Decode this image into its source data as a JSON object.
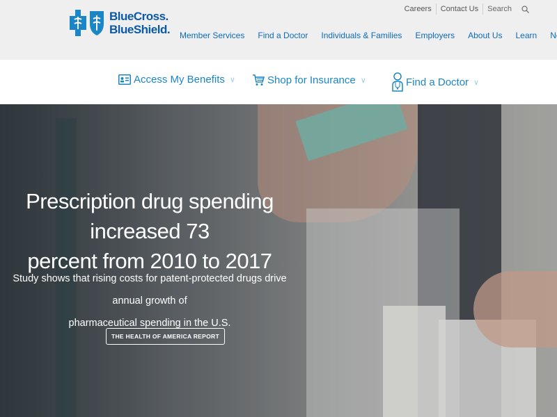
{
  "brand": {
    "line1": "BlueCross.",
    "line2": "BlueShield.",
    "color": "#0b5aa6"
  },
  "utility_nav": {
    "links": [
      "Careers",
      "Contact Us"
    ],
    "search_label": "Search",
    "search_icon": "search-icon"
  },
  "main_nav": {
    "items": [
      "Member Services",
      "Find a Doctor",
      "Individuals & Families",
      "Employers",
      "About Us",
      "Learn",
      "News"
    ],
    "color": "#0b6bbd"
  },
  "quick_actions": [
    {
      "label": "Access My Benefits",
      "icon": "id-card-icon"
    },
    {
      "label": "Shop for Insurance",
      "icon": "shopping-cart-icon"
    },
    {
      "label": "Find a Doctor",
      "icon": "doctor-icon"
    }
  ],
  "hero": {
    "title_line1": "Prescription drug spending increased 73",
    "title_line2": "percent from 2010 to 2017",
    "subtitle_line1": "Study shows that rising costs for patent-protected drugs drive annual growth of",
    "subtitle_line2": "pharmaceutical spending in the U.S.",
    "button_label": "THE HEALTH OF AMERICA REPORT"
  },
  "colors": {
    "accent": "#1a86c8",
    "header_bg": "#efefef"
  }
}
